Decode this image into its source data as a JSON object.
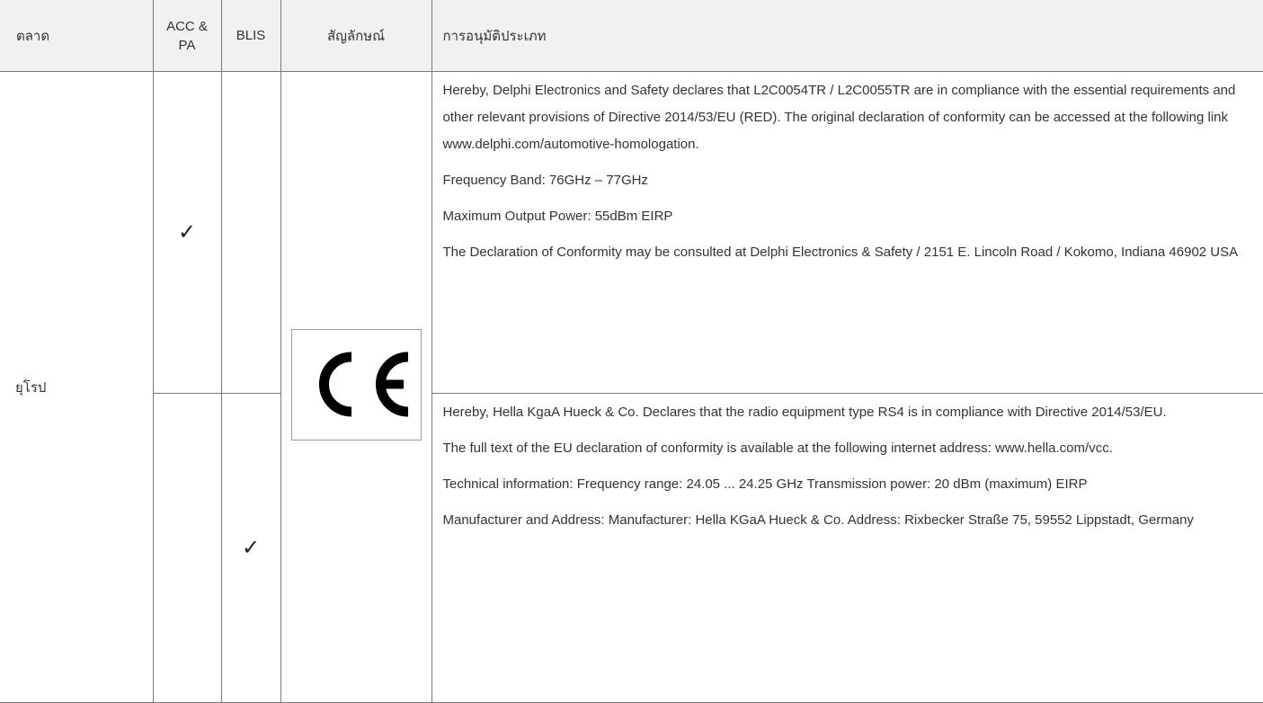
{
  "header": {
    "market": "ตลาด",
    "acc_pa": "ACC & PA",
    "blis": "BLIS",
    "symbol": "สัญลักษณ์",
    "type_approval": "การอนุมัติประเภท"
  },
  "rows": [
    {
      "market": "ยุโรป",
      "acc_check": "✓",
      "blis_check": "",
      "symbol_icon": "ce-mark-icon",
      "symbol_letters": "CE",
      "paragraphs": [
        "Hereby, Delphi Electronics and Safety declares that L2C0054TR / L2C0055TR are in compliance with the essential requirements and other relevant provisions of Directive 2014/53/EU (RED). The original declaration of conformity can be accessed at the following link www.delphi.com/automotive-homologation.",
        "Frequency Band: 76GHz – 77GHz",
        "Maximum Output Power: 55dBm EIRP",
        "The Declaration of Conformity may be consulted at Delphi Electronics & Safety / 2151 E. Lincoln Road / Kokomo, Indiana 46902 USA"
      ]
    },
    {
      "acc_check": "",
      "blis_check": "✓",
      "paragraphs": [
        "Hereby, Hella KgaA Hueck & Co. Declares that the radio equipment type RS4 is in compliance with Directive 2014/53/EU.",
        "The full text of the EU declaration of conformity is available at the following internet address: www.hella.com/vcc.",
        "Technical information: Frequency range: 24.05 ... 24.25 GHz Transmission power: 20 dBm (maximum) EIRP",
        "Manufacturer and Address: Manufacturer: Hella KGaA Hueck & Co. Address: Rixbecker Straße 75, 59552 Lippstadt, Germany"
      ]
    }
  ]
}
